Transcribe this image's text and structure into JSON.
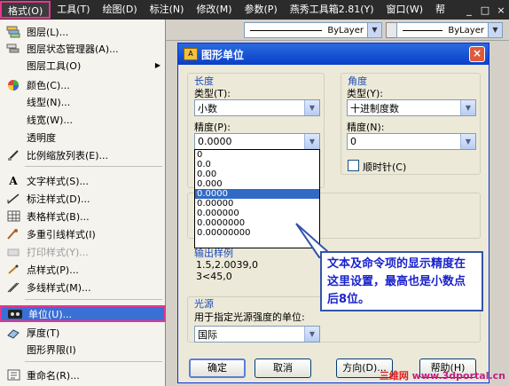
{
  "menubar": {
    "items": [
      "格式(O)",
      "工具(T)",
      "绘图(D)",
      "标注(N)",
      "修改(M)",
      "参数(P)",
      "燕秀工具箱2.81(Y)",
      "窗口(W)",
      "帮"
    ],
    "window_buttons": [
      "_",
      "□",
      "×"
    ]
  },
  "toolbar": {
    "linetype_value": "ByLayer",
    "lineweight_value": "ByLayer"
  },
  "format_menu": {
    "items": [
      {
        "label": "图层(L)...",
        "icon": "layers-icon"
      },
      {
        "label": "图层状态管理器(A)...",
        "icon": "layer-state-icon"
      },
      {
        "label": "图层工具(O)",
        "icon": "",
        "submenu": true
      },
      {
        "label": "颜色(C)...",
        "icon": "color-wheel-icon"
      },
      {
        "label": "线型(N)...",
        "icon": ""
      },
      {
        "label": "线宽(W)...",
        "icon": ""
      },
      {
        "label": "透明度",
        "icon": ""
      },
      {
        "label": "比例缩放列表(E)...",
        "icon": "scale-list-icon"
      },
      {
        "label": "文字样式(S)...",
        "icon": "text-style-icon"
      },
      {
        "label": "标注样式(D)...",
        "icon": "dim-style-icon"
      },
      {
        "label": "表格样式(B)...",
        "icon": "table-style-icon"
      },
      {
        "label": "多重引线样式(I)",
        "icon": "mleader-style-icon"
      },
      {
        "label": "打印样式(Y)...",
        "icon": "plot-style-icon",
        "disabled": true
      },
      {
        "label": "点样式(P)...",
        "icon": "point-style-icon"
      },
      {
        "label": "多线样式(M)...",
        "icon": "mline-style-icon"
      },
      {
        "label": "单位(U)...",
        "icon": "units-icon",
        "highlighted": true
      },
      {
        "label": "厚度(T)",
        "icon": "thickness-icon"
      },
      {
        "label": "图形界限(I)",
        "icon": ""
      },
      {
        "label": "重命名(R)...",
        "icon": "rename-icon"
      }
    ]
  },
  "dialog": {
    "title": "图形单位",
    "length": {
      "group_label": "长度",
      "type_label": "类型(T):",
      "type_value": "小数",
      "precision_label": "精度(P):",
      "precision_value": "0.0000",
      "precision_options": [
        "0",
        "0.0",
        "0.00",
        "0.000",
        "0.0000",
        "0.00000",
        "0.000000",
        "0.0000000",
        "0.00000000"
      ],
      "selected_option": 4
    },
    "angle": {
      "group_label": "角度",
      "type_label": "类型(Y):",
      "type_value": "十进制度数",
      "precision_label": "精度(N):",
      "precision_value": "0",
      "clockwise_label": "顺时针(C)",
      "clockwise_checked": false
    },
    "output_sample": {
      "label": "输出样例",
      "line1": "1.5,2.0039,0",
      "line2": "3<45,0"
    },
    "lighting": {
      "group_label": "光源",
      "intensity_label": "用于指定光源强度的单位:",
      "intensity_value": "国际"
    },
    "buttons": {
      "ok": "确定",
      "cancel": "取消",
      "direction": "方向(D)...",
      "help": "帮助(H)"
    }
  },
  "callout": {
    "text": "文本及命令项的显示精度在这里设置，最高也是小数点后8位。"
  },
  "watermark": {
    "part1": "三维网",
    "part2": "www.3dportal.cn"
  },
  "colors": {
    "menu_highlight": "#3a6fd4",
    "annotation_border": "#e8358e",
    "dialog_title": "#0a3fc8",
    "callout_text": "#1a22cc"
  }
}
